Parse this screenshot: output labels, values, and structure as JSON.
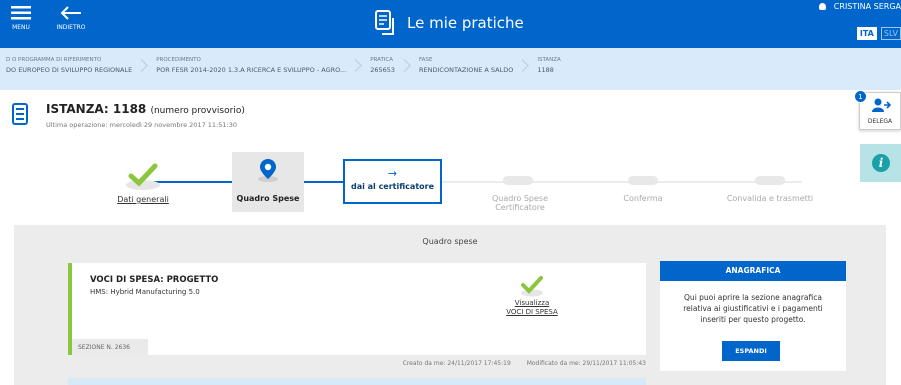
{
  "header": {
    "menu_label": "MENU",
    "back_label": "INDIETRO",
    "title": "Le mie pratiche",
    "user_name": "CRISTINA SERGA",
    "langs": [
      "ITA",
      "SLV"
    ]
  },
  "breadcrumb": [
    {
      "key": "D O PROGRAMMA DI RIFERIMENTO",
      "value": "DO EUROPEO DI SVILUPPO REGIONALE"
    },
    {
      "key": "PROCEDIMENTO",
      "value": "POR FESR 2014-2020 1.3.A RICERCA E SVILUPPO - AGRO..."
    },
    {
      "key": "PRATICA",
      "value": "265653"
    },
    {
      "key": "FASE",
      "value": "RENDICONTAZIONE A SALDO"
    },
    {
      "key": "ISTANZA",
      "value": "1188"
    }
  ],
  "heading": {
    "title": "ISTANZA: 1188",
    "subtitle": "(numero provvisorio)",
    "last_op": "Ultima operazione: mercoledì 29 novembre 2017 11:51:30"
  },
  "delega": {
    "badge": "1",
    "label": "DELEGA"
  },
  "stepper": {
    "steps": [
      {
        "label": "Dati generali",
        "status": "done"
      },
      {
        "label": "Quadro Spese",
        "status": "current"
      },
      {
        "label": "dai al certificatore",
        "status": "action"
      },
      {
        "label_line1": "Quadro Spese",
        "label_line2": "Certificatore",
        "status": "future"
      },
      {
        "label": "Conferma",
        "status": "future"
      },
      {
        "label": "Convalida e trasmetti",
        "status": "future"
      }
    ]
  },
  "panel": {
    "title": "Quadro spese",
    "card": {
      "heading": "VOCI DI SPESA: PROGETTO",
      "project": "HMS: Hybrid Manufacturing 5.0",
      "link_line1": "Visualizza",
      "link_line2": "VOCI DI SPESA",
      "section": "SEZIONE N. 2636",
      "created": "Creato da me: 24/11/2017 17:45:19",
      "modified": "Modificato da me: 29/11/2017 11:05:43"
    },
    "anagrafica": {
      "title": "ANAGRAFICA",
      "text": "Qui puoi aprire la sezione anagrafica relativa ai giustificativi e i pagamenti inseriti per questo progetto.",
      "button": "ESPANDI"
    }
  },
  "colors": {
    "brand_blue": "#0066cc",
    "breadcrumb_bg": "#d9eafb",
    "done_green": "#8cc63f",
    "info_teal": "#1aa0a8"
  }
}
